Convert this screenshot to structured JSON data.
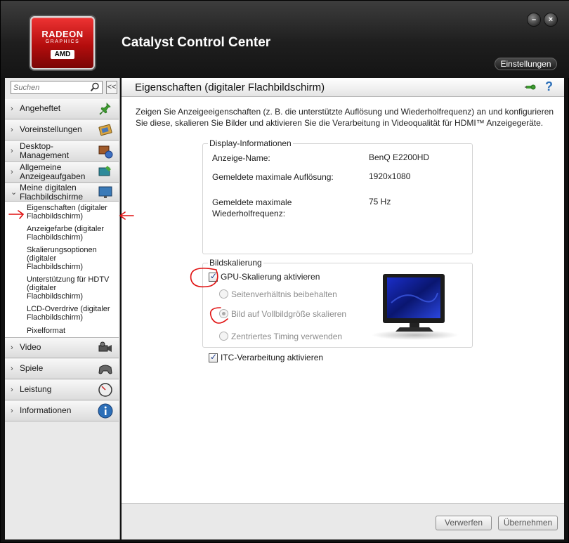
{
  "app": {
    "title": "Catalyst Control Center",
    "settings_label": "Einstellungen",
    "logo": {
      "brand": "RADEON",
      "sub": "GRAPHICS",
      "maker": "AMD"
    },
    "min_glyph": "–",
    "close_glyph": "×"
  },
  "sidebar": {
    "search_placeholder": "Suchen",
    "collapse_glyph": "<<",
    "items": [
      {
        "label": "Angeheftet",
        "icon": "pin-icon"
      },
      {
        "label": "Voreinstellungen",
        "icon": "presets-icon"
      },
      {
        "label": "Desktop-\nManagement",
        "icon": "desktop-management-icon"
      },
      {
        "label": "Allgemeine\nAnzeigeaufgaben",
        "icon": "display-tasks-icon"
      },
      {
        "label": "Meine digitalen\nFlachbildschirme",
        "icon": "flat-panel-icon",
        "expanded": true
      },
      {
        "label": "Video",
        "icon": "video-camera-icon"
      },
      {
        "label": "Spiele",
        "icon": "gamepad-icon"
      },
      {
        "label": "Leistung",
        "icon": "gauge-icon"
      },
      {
        "label": "Informationen",
        "icon": "info-icon"
      }
    ],
    "sub_items": [
      {
        "label": "Eigenschaften (digitaler\nFlachbildschirm)",
        "selected": true
      },
      {
        "label": "Anzeigefarbe (digitaler\nFlachbildschirm)"
      },
      {
        "label": "Skalierungsoptionen\n(digitaler\nFlachbildschirm)"
      },
      {
        "label": "Unterstützung für HDTV\n(digitaler\nFlachbildschirm)"
      },
      {
        "label": "LCD-Overdrive (digitaler\nFlachbildschirm)"
      },
      {
        "label": "Pixelformat"
      }
    ]
  },
  "main": {
    "title": "Eigenschaften (digitaler Flachbildschirm)",
    "help_glyph": "?",
    "description": "Zeigen Sie Anzeigeeigenschaften (z. B. die unterstützte Auflösung und Wiederholfrequenz) an und konfigurieren Sie diese, skalieren Sie Bilder und aktivieren Sie die Verarbeitung in Videoqualität für HDMI™ Anzeigegeräte.",
    "display_info": {
      "title": "Display-Informationen",
      "rows": [
        {
          "label": "Anzeige-Name:",
          "value": "BenQ E2200HD"
        },
        {
          "label": "Gemeldete maximale Auflösung:",
          "value": "1920x1080"
        },
        {
          "label": "Gemeldete maximale\nWiederholfrequenz:",
          "value": "75 Hz"
        }
      ]
    },
    "scaling": {
      "title": "Bildskalierung",
      "gpu_scaling_label": "GPU-Skalierung aktivieren",
      "gpu_scaling_checked": true,
      "options": [
        {
          "label": "Seitenverhältnis beibehalten",
          "selected": false
        },
        {
          "label": "Bild auf Vollbildgröße skalieren",
          "selected": true
        },
        {
          "label": "Zentriertes Timing verwenden",
          "selected": false
        }
      ]
    },
    "itc_label": "ITC-Verarbeitung aktivieren",
    "itc_checked": true,
    "buttons": {
      "discard": "Verwerfen",
      "apply": "Übernehmen"
    }
  },
  "colors": {
    "annotation": "#e01010",
    "accent_blue": "#2c6fb8",
    "logo_red": "#c41212"
  }
}
